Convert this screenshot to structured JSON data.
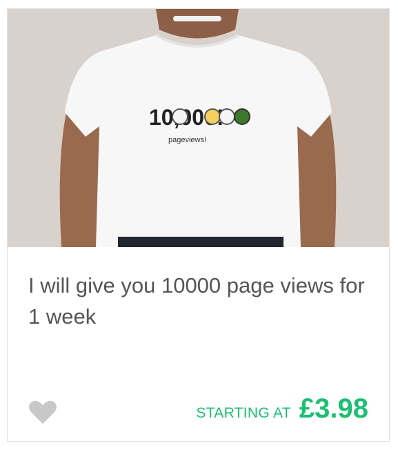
{
  "gig": {
    "image_print": {
      "number": "10,000!",
      "caption": "pageviews!"
    },
    "title": "I will give you 10000 page views for 1 week",
    "starting_label": "STARTING AT",
    "price": "£3.98",
    "favorite_icon": "heart-icon"
  },
  "colors": {
    "price": "#1dbf73",
    "title": "#555555",
    "heart": "#c8c8c8",
    "image_background": "#dad2cc"
  }
}
